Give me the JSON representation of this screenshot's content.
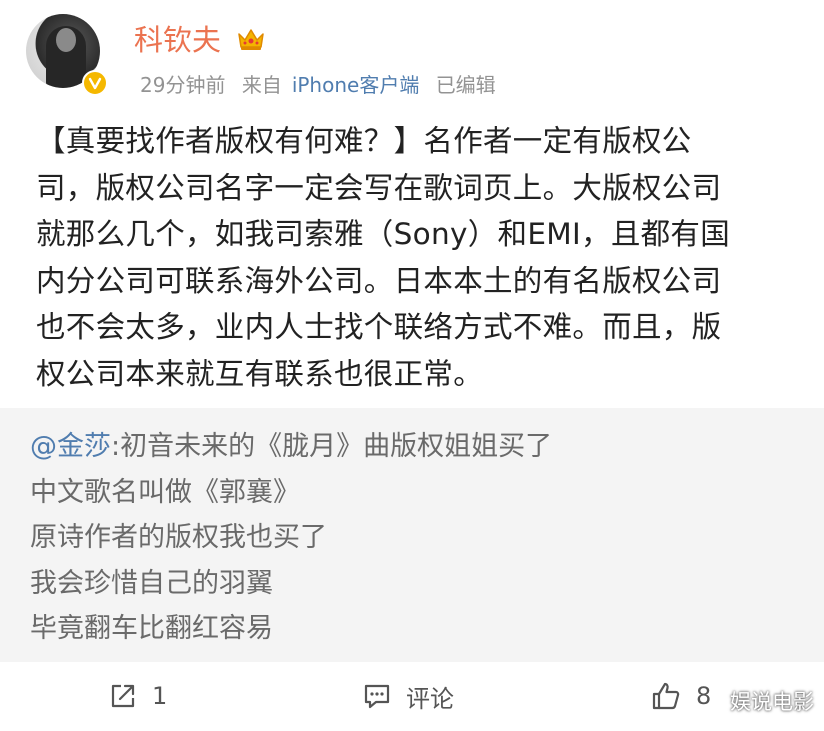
{
  "header": {
    "username": "科钦夫",
    "time": "29分钟前",
    "source_prefix": "来自",
    "source_app": "iPhone客户端",
    "edited": "已编辑"
  },
  "post": {
    "lines": [
      "【真要找作者版权有何难？】名作者一定有版权公",
      "司，版权公司名字一定会写在歌词页上。大版权公司",
      "就那么几个，如我司索雅（Sony）和EMI，且都有国",
      "内分公司可联系海外公司。日本本土的有名版权公司",
      "也不会太多，业内人士找个联络方式不难。而且，版",
      "权公司本来就互有联系也很正常。"
    ]
  },
  "repost": {
    "mention": "@金莎",
    "first_line": ":初音未来的《胧月》曲版权姐姐买了",
    "lines": [
      "中文歌名叫做《郭襄》",
      "原诗作者的版权我也买了",
      "我会珍惜自己的羽翼",
      "毕竟翻车比翻红容易"
    ]
  },
  "actions": {
    "repost_count": "1",
    "comment_label": "评论",
    "like_count": "8"
  },
  "watermark": "娱说电影",
  "colors": {
    "username": "#eb7350",
    "link": "#507daf",
    "meta": "#939393",
    "repost_bg": "#f4f4f4"
  }
}
